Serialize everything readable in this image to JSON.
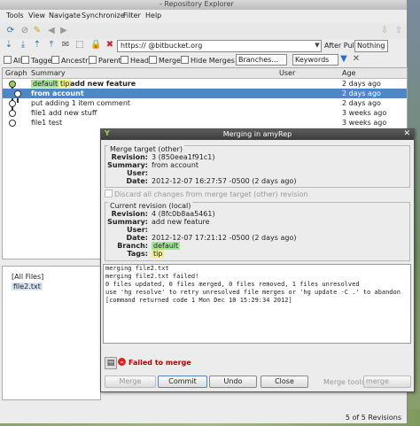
{
  "window": {
    "title": "- Repository Explorer"
  },
  "menu": [
    "Tools",
    "View",
    "Navigate",
    "Synchronize",
    "Filter",
    "Help"
  ],
  "urlbar": {
    "url": "https://              @bitbucket.org",
    "after_pull_label": "After Pull:",
    "after_pull_value": "Nothing"
  },
  "filterbar": {
    "all": "All",
    "tagged": "Tagged",
    "ancestry": "Ancestry",
    "parents": "Parents",
    "heads": "Heads",
    "merges": "Merges",
    "hide_merges": "Hide Merges",
    "branches": "Branches...",
    "keywords": "Keywords"
  },
  "table": {
    "headers": [
      "Graph",
      "Summary",
      "User",
      "Age"
    ],
    "rows": [
      {
        "tag1": "default",
        "tag2": "tip",
        "summary": "add new feature",
        "age": "2 days ago"
      },
      {
        "summary": "from                 account",
        "age": "2 days ago"
      },
      {
        "summary": "put adding 1 item comment",
        "age": "2 days ago"
      },
      {
        "summary": "file1 add new stuff",
        "age": "3 weeks ago"
      },
      {
        "summary": "file1 test",
        "age": "3 weeks ago"
      }
    ]
  },
  "lowerpanel": {
    "items": [
      "[All Files]",
      "file2.txt"
    ]
  },
  "status": {
    "revisions": "5 of 5 Revisions"
  },
  "dialog": {
    "title": "Merging in amyRep",
    "merge_target": {
      "title": "Merge target (other)",
      "revision_label": "Revision:",
      "revision": "3 (850eea1f91c1)",
      "summary_label": "Summary:",
      "summary": "from            account",
      "user_label": "User:",
      "user": "",
      "date_label": "Date:",
      "date": "2012-12-07 16:27:57 -0500 (2 days ago)"
    },
    "discard_label": "Discard all changes from merge target (other) revision",
    "current": {
      "title": "Current revision (local)",
      "revision_label": "Revision:",
      "revision": "4 (8fc0b8aa5461)",
      "summary_label": "Summary:",
      "summary": "add new feature",
      "user_label": "User:",
      "user": "",
      "date_label": "Date:",
      "date": "2012-12-07 17:21:12 -0500 (2 days ago)",
      "branch_label": "Branch:",
      "branch": "default",
      "tags_label": "Tags:",
      "tags": "tip"
    },
    "output": [
      "merging file2.txt",
      "merging file2.txt failed!",
      "0 files updated, 0 files merged, 0 files removed, 1 files unresolved",
      "use 'hg resolve' to retry unresolved file merges or 'hg update -C .' to abandon",
      "[command returned code 1 Mon Dec 10 15:29:34 2012]"
    ],
    "status": "Failed to merge",
    "buttons": {
      "merge": "Merge",
      "commit": "Commit",
      "undo": "Undo",
      "close": "Close"
    },
    "merge_tools_label": "Merge tools:",
    "merge_tools_value": "merge"
  }
}
